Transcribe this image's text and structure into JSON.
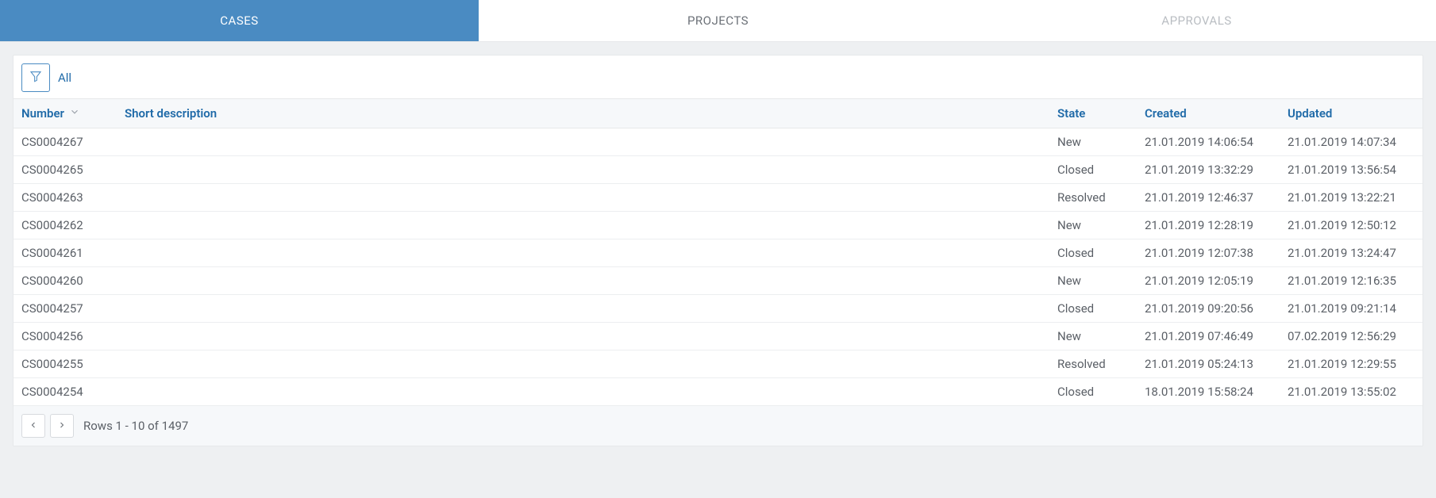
{
  "tabs": [
    {
      "label": "CASES",
      "active": true
    },
    {
      "label": "PROJECTS",
      "active": false
    },
    {
      "label": "APPROVALS",
      "active": false
    }
  ],
  "toolbar": {
    "filter_label": "All"
  },
  "columns": {
    "number": "Number",
    "short_description": "Short description",
    "state": "State",
    "created": "Created",
    "updated": "Updated"
  },
  "rows": [
    {
      "number": "CS0004267",
      "short_description": "",
      "state": "New",
      "created": "21.01.2019 14:06:54",
      "updated": "21.01.2019 14:07:34"
    },
    {
      "number": "CS0004265",
      "short_description": "",
      "state": "Closed",
      "created": "21.01.2019 13:32:29",
      "updated": "21.01.2019 13:56:54"
    },
    {
      "number": "CS0004263",
      "short_description": "",
      "state": "Resolved",
      "created": "21.01.2019 12:46:37",
      "updated": "21.01.2019 13:22:21"
    },
    {
      "number": "CS0004262",
      "short_description": "",
      "state": "New",
      "created": "21.01.2019 12:28:19",
      "updated": "21.01.2019 12:50:12"
    },
    {
      "number": "CS0004261",
      "short_description": "",
      "state": "Closed",
      "created": "21.01.2019 12:07:38",
      "updated": "21.01.2019 13:24:47"
    },
    {
      "number": "CS0004260",
      "short_description": "",
      "state": "New",
      "created": "21.01.2019 12:05:19",
      "updated": "21.01.2019 12:16:35"
    },
    {
      "number": "CS0004257",
      "short_description": "",
      "state": "Closed",
      "created": "21.01.2019 09:20:56",
      "updated": "21.01.2019 09:21:14"
    },
    {
      "number": "CS0004256",
      "short_description": "",
      "state": "New",
      "created": "21.01.2019 07:46:49",
      "updated": "07.02.2019 12:56:29"
    },
    {
      "number": "CS0004255",
      "short_description": "",
      "state": "Resolved",
      "created": "21.01.2019 05:24:13",
      "updated": "21.01.2019 12:29:55"
    },
    {
      "number": "CS0004254",
      "short_description": "",
      "state": "Closed",
      "created": "18.01.2019 15:58:24",
      "updated": "21.01.2019 13:55:02"
    }
  ],
  "pager": {
    "text": "Rows 1 - 10 of 1497"
  }
}
